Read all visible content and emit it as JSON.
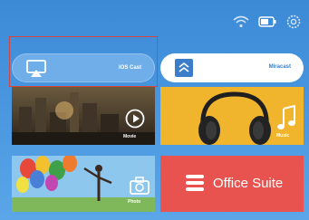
{
  "status": {
    "wifi_icon": "wifi-icon",
    "battery_icon": "battery-icon",
    "settings_icon": "gear-icon"
  },
  "cast": {
    "ios_label": "IOS Cast",
    "miracast_label": "Miracast"
  },
  "tiles": {
    "movie_label": "Movie",
    "music_label": "Music",
    "photo_label": "Photo",
    "office_label": "Office Suite"
  },
  "colors": {
    "background": "#4a97e0",
    "highlight": "#d6453d",
    "music_tile": "#f0b52d",
    "office_tile": "#e9534f"
  }
}
